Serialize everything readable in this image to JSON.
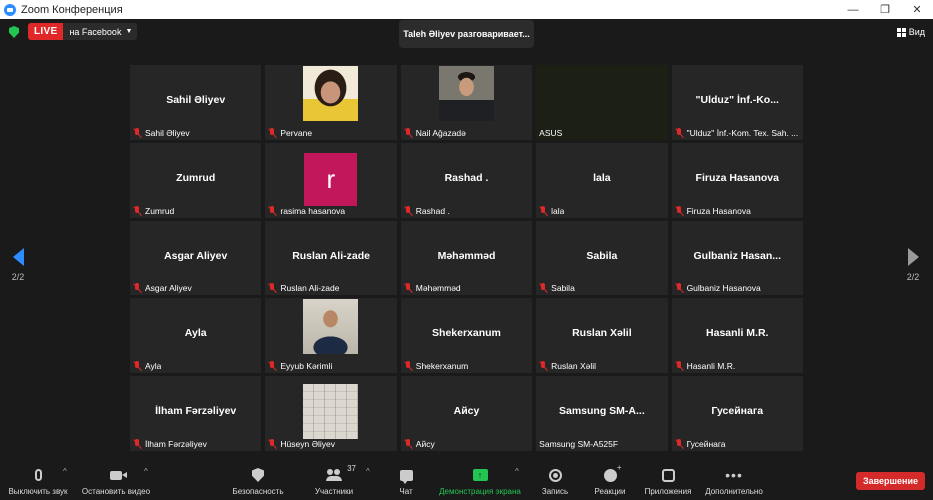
{
  "window": {
    "title": "Zoom Конференция",
    "controls": [
      "—",
      "❐",
      "✕"
    ]
  },
  "topbar": {
    "live_label": "LIVE",
    "live_target": "на Facebook",
    "speaker_tip": "Taleh Əliyev разговаривает...",
    "view_label": "Вид"
  },
  "pagination": {
    "left_label": "2/2",
    "right_label": "2/2"
  },
  "tiles": [
    {
      "big": "Sahil Əliyev",
      "label": "Sahil Əliyev",
      "video": "",
      "muted": true
    },
    {
      "big": "",
      "label": "Pervane",
      "video": "cam-woman",
      "muted": true
    },
    {
      "big": "",
      "label": "Nail Ağazadə",
      "video": "cam-man1",
      "muted": true
    },
    {
      "big": "",
      "label": "ASUS",
      "video": "dark",
      "muted": false
    },
    {
      "big": "\"Ulduz\"  İnf.-Ko...",
      "label": "\"Ulduz\" İnf.-Kom. Tex. Sah. ...",
      "video": "",
      "muted": true
    },
    {
      "big": "Zumrud",
      "label": "Zumrud",
      "video": "",
      "muted": true
    },
    {
      "big": "",
      "label": "rasima hasanova",
      "video": "avatar-r",
      "avatar_letter": "r",
      "muted": true
    },
    {
      "big": "Rashad .",
      "label": "Rashad .",
      "video": "",
      "muted": true
    },
    {
      "big": "lala",
      "label": "lala",
      "video": "",
      "muted": true
    },
    {
      "big": "Firuza Hasanova",
      "label": "Firuza Hasanova",
      "video": "",
      "muted": true
    },
    {
      "big": "Asgar Aliyev",
      "label": "Asgar Aliyev",
      "video": "",
      "muted": true
    },
    {
      "big": "Ruslan Ali-zade",
      "label": "Ruslan Ali-zade",
      "video": "",
      "muted": true
    },
    {
      "big": "Məhəmməd",
      "label": "Məhəmməd",
      "video": "",
      "muted": true
    },
    {
      "big": "Sabila",
      "label": "Sabila",
      "video": "",
      "muted": true
    },
    {
      "big": "Gulbaniz  Hasan...",
      "label": "Gulbaniz Hasanova",
      "video": "",
      "muted": true
    },
    {
      "big": "Ayla",
      "label": "Ayla",
      "video": "",
      "muted": true
    },
    {
      "big": "",
      "label": "Eyyub Kərimli",
      "video": "cam-man2",
      "muted": true
    },
    {
      "big": "Shekerxanum",
      "label": "Shekerxanum",
      "video": "",
      "muted": true
    },
    {
      "big": "Ruslan Xəlil",
      "label": "Ruslan Xəlil",
      "video": "",
      "muted": true
    },
    {
      "big": "Hasanli M.R.",
      "label": "Hasanli M.R.",
      "video": "",
      "muted": true
    },
    {
      "big": "İlham Fərzəliyev",
      "label": "İlham Fərzəliyev",
      "video": "",
      "muted": true
    },
    {
      "big": "",
      "label": "Hüseyn Əliyev",
      "video": "cam-paper",
      "muted": true
    },
    {
      "big": "Айсу",
      "label": "Айсу",
      "video": "",
      "muted": true
    },
    {
      "big": "Samsung  SM-A...",
      "label": "Samsung SM-A525F",
      "video": "",
      "muted": false
    },
    {
      "big": "Гусейнага",
      "label": "Гусейнага",
      "video": "",
      "muted": true
    }
  ],
  "toolbar": {
    "mute": "Выключить звук",
    "video": "Остановить видео",
    "security": "Безопасность",
    "participants": "Участники",
    "participants_count": "37",
    "chat": "Чат",
    "share": "Демонстрация экрана",
    "record": "Запись",
    "reactions": "Реакции",
    "apps": "Приложения",
    "more": "Дополнительно",
    "end": "Завершение"
  },
  "colors": {
    "live_red": "#e02828",
    "accent_blue": "#2d8cff",
    "share_green": "#23c552",
    "end_red": "#d42a2a"
  }
}
